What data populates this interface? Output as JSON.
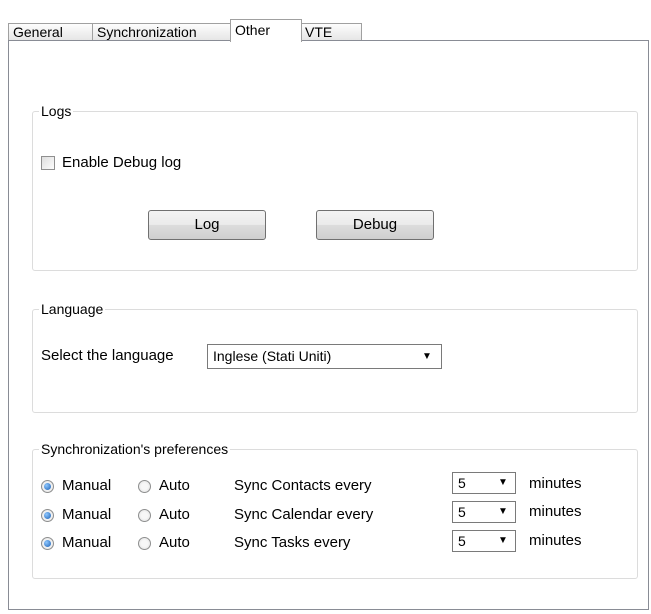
{
  "tabs": [
    "General",
    "Synchronization",
    "Other",
    "VTE"
  ],
  "active_tab": "Other",
  "logs": {
    "title": "Logs",
    "enable_debug_label": "Enable Debug log",
    "enable_debug_checked": false,
    "log_button": "Log",
    "debug_button": "Debug"
  },
  "language": {
    "title": "Language",
    "select_label": "Select the language",
    "selected": "Inglese (Stati Uniti)"
  },
  "sync_prefs": {
    "title": "Synchronization's preferences",
    "manual_label": "Manual",
    "auto_label": "Auto",
    "minutes_label": "minutes",
    "rows": [
      {
        "label": "Sync Contacts every",
        "value": "5",
        "mode": "Manual"
      },
      {
        "label": "Sync Calendar every",
        "value": "5",
        "mode": "Manual"
      },
      {
        "label": "Sync Tasks every",
        "value": "5",
        "mode": "Manual"
      }
    ]
  }
}
